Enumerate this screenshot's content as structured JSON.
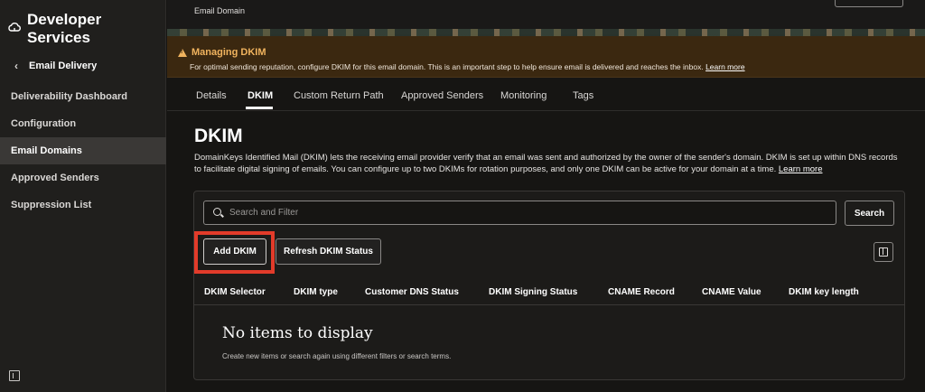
{
  "sidebar": {
    "title": "Developer Services",
    "back_label": "Email Delivery",
    "items": [
      {
        "label": "Deliverability Dashboard"
      },
      {
        "label": "Configuration"
      },
      {
        "label": "Email Domains"
      },
      {
        "label": "Approved Senders"
      },
      {
        "label": "Suppression List"
      }
    ],
    "active_item": "Email Domains"
  },
  "header": {
    "subtitle": "Email Domain"
  },
  "banner": {
    "title": "Managing DKIM",
    "text": "For optimal sending reputation, configure DKIM for this email domain. This is an important step to help ensure email is delivered and reaches the inbox.",
    "link": "Learn more",
    "color": "#f0b35e"
  },
  "tabs": [
    {
      "label": "Details"
    },
    {
      "label": "DKIM"
    },
    {
      "label": "Custom Return Path"
    },
    {
      "label": "Approved Senders"
    },
    {
      "label": "Monitoring"
    },
    {
      "label": "Tags"
    }
  ],
  "active_tab": "DKIM",
  "main": {
    "title": "DKIM",
    "description": "DomainKeys Identified Mail (DKIM) lets the receiving email provider verify that an email was sent and authorized by the owner of the sender's domain. DKIM is set up within DNS records to facilitate digital signing of emails. You can configure up to two DKIMs for rotation purposes, and only one DKIM can be active for your domain at a time.",
    "learn_more": "Learn more"
  },
  "search": {
    "placeholder": "Search and Filter",
    "button": "Search"
  },
  "actions": {
    "add_dkim": "Add DKIM",
    "refresh": "Refresh DKIM Status",
    "highlight_color": "#e23b2a"
  },
  "table": {
    "columns": [
      "DKIM Selector",
      "DKIM type",
      "Customer DNS Status",
      "DKIM Signing Status",
      "CNAME Record",
      "CNAME Value",
      "DKIM key length"
    ],
    "empty_title": "No items to display",
    "empty_subtitle": "Create new items or search again using different filters or search terms."
  },
  "icons": [
    "cloud-icon",
    "chevron-left-icon",
    "warning-icon",
    "search-icon",
    "columns-icon",
    "collapse-sidebar-icon"
  ]
}
